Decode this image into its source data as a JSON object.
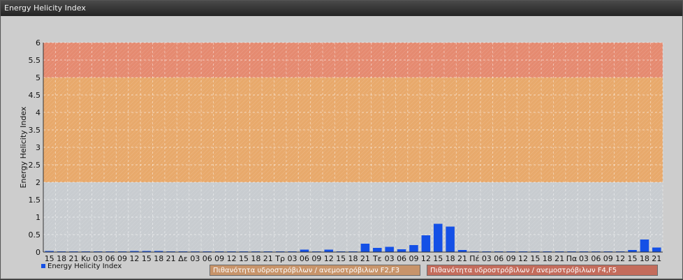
{
  "window": {
    "title": "Energy Helicity Index"
  },
  "legend": {
    "series_label": "Energy Helicity Index"
  },
  "bands": [
    {
      "label": "Πιθανότητα υδροστρόβιλων / ανεμοστρόβιλων F2,F3",
      "from": 2,
      "to": 5,
      "color": "#e8a96b"
    },
    {
      "label": "Πιθανότητα υδροστρόβιλων / ανεμοστρόβιλων F4,F5",
      "from": 5,
      "to": 6,
      "color": "#e58a70"
    }
  ],
  "colors": {
    "bar": "#1450e6",
    "plot_bg": "#c8ccd0"
  },
  "chart_data": {
    "type": "bar",
    "title": "",
    "xlabel": "",
    "ylabel": "Energy Helicity Index",
    "ylim": [
      0,
      6
    ],
    "yticks": [
      0,
      0.5,
      1,
      1.5,
      2,
      2.5,
      3,
      3.5,
      4,
      4.5,
      5,
      5.5,
      6
    ],
    "grid": true,
    "legend_position": "bottom-left",
    "categories": [
      "15",
      "18",
      "21",
      "Κυ",
      "03",
      "06",
      "09",
      "12",
      "15",
      "18",
      "21",
      "Δε",
      "03",
      "06",
      "09",
      "12",
      "15",
      "18",
      "21",
      "Τρ",
      "03",
      "06",
      "09",
      "12",
      "15",
      "18",
      "21",
      "Τε",
      "03",
      "06",
      "09",
      "12",
      "15",
      "18",
      "21",
      "Πέ",
      "03",
      "06",
      "09",
      "12",
      "15",
      "18",
      "21",
      "Πα",
      "03",
      "06",
      "09",
      "12",
      "15",
      "18",
      "21"
    ],
    "series": [
      {
        "name": "Energy Helicity Index",
        "values": [
          0.03,
          0.02,
          0.02,
          0.02,
          0.02,
          0.02,
          0.02,
          0.03,
          0.03,
          0.03,
          0.02,
          0.02,
          0.02,
          0.02,
          0.02,
          0.02,
          0.02,
          0.02,
          0.02,
          0.02,
          0.02,
          0.07,
          0.02,
          0.07,
          0.02,
          0.02,
          0.24,
          0.12,
          0.15,
          0.08,
          0.2,
          0.48,
          0.81,
          0.73,
          0.06,
          0.02,
          0.02,
          0.02,
          0.02,
          0.02,
          0.02,
          0.02,
          0.02,
          0.02,
          0.02,
          0.02,
          0.02,
          0.02,
          0.06,
          0.36,
          0.13
        ]
      }
    ]
  }
}
